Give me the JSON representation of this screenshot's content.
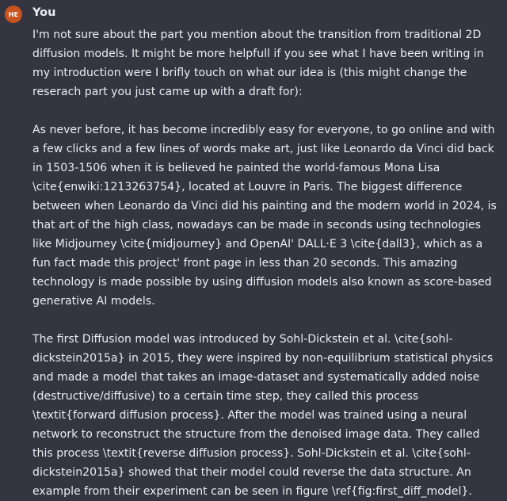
{
  "message": {
    "avatar_initials": "HE",
    "avatar_color": "#c9541f",
    "author": "You",
    "paragraphs": [
      "I'm not sure about the part you mention about the transition from traditional 2D diffusion models. It might be more helpfull if you see what I have been writing in my introduction were I brifly touch on what our idea is (this might change the reserach part you just came up with a draft for):",
      "As never before, it has become incredibly easy for everyone, to go online and with a few clicks and a few lines of words make art, just like Leonardo da Vinci did back in 1503-1506 when it is believed he painted the world-famous Mona Lisa \\cite{enwiki:1213263754}, located at Louvre in Paris. The biggest difference between when Leonardo da Vinci did his painting and the modern world in 2024, is that art of the high class, nowadays can be made in seconds using technologies like Midjourney \\cite{midjourney} and OpenAI' DALL·E 3 \\cite{dall3}, which as a fun fact made this project' front page in less than 20 seconds. This amazing technology is made possible by using diffusion models also known as score-based generative AI models.",
      "The first Diffusion model was introduced by Sohl-Dickstein et al. \\cite{sohl-dickstein2015a} in 2015, they were inspired by non-equilibrium statistical physics and made a model that takes an image-dataset and systematically added noise (destructive/diffusive) to a certain time step, they called this process \\textit{forward diffusion process}. After the model was trained using a neural network to reconstruct the structure from the denoised image data. They called this process \\textit{reverse diffusion process}. Sohl-Dickstein et al. \\cite{sohl-dickstein2015a} showed that their model could reverse the data structure. An example from their experiment can be seen in figure \\ref{fig:first_diff_model}."
    ]
  }
}
